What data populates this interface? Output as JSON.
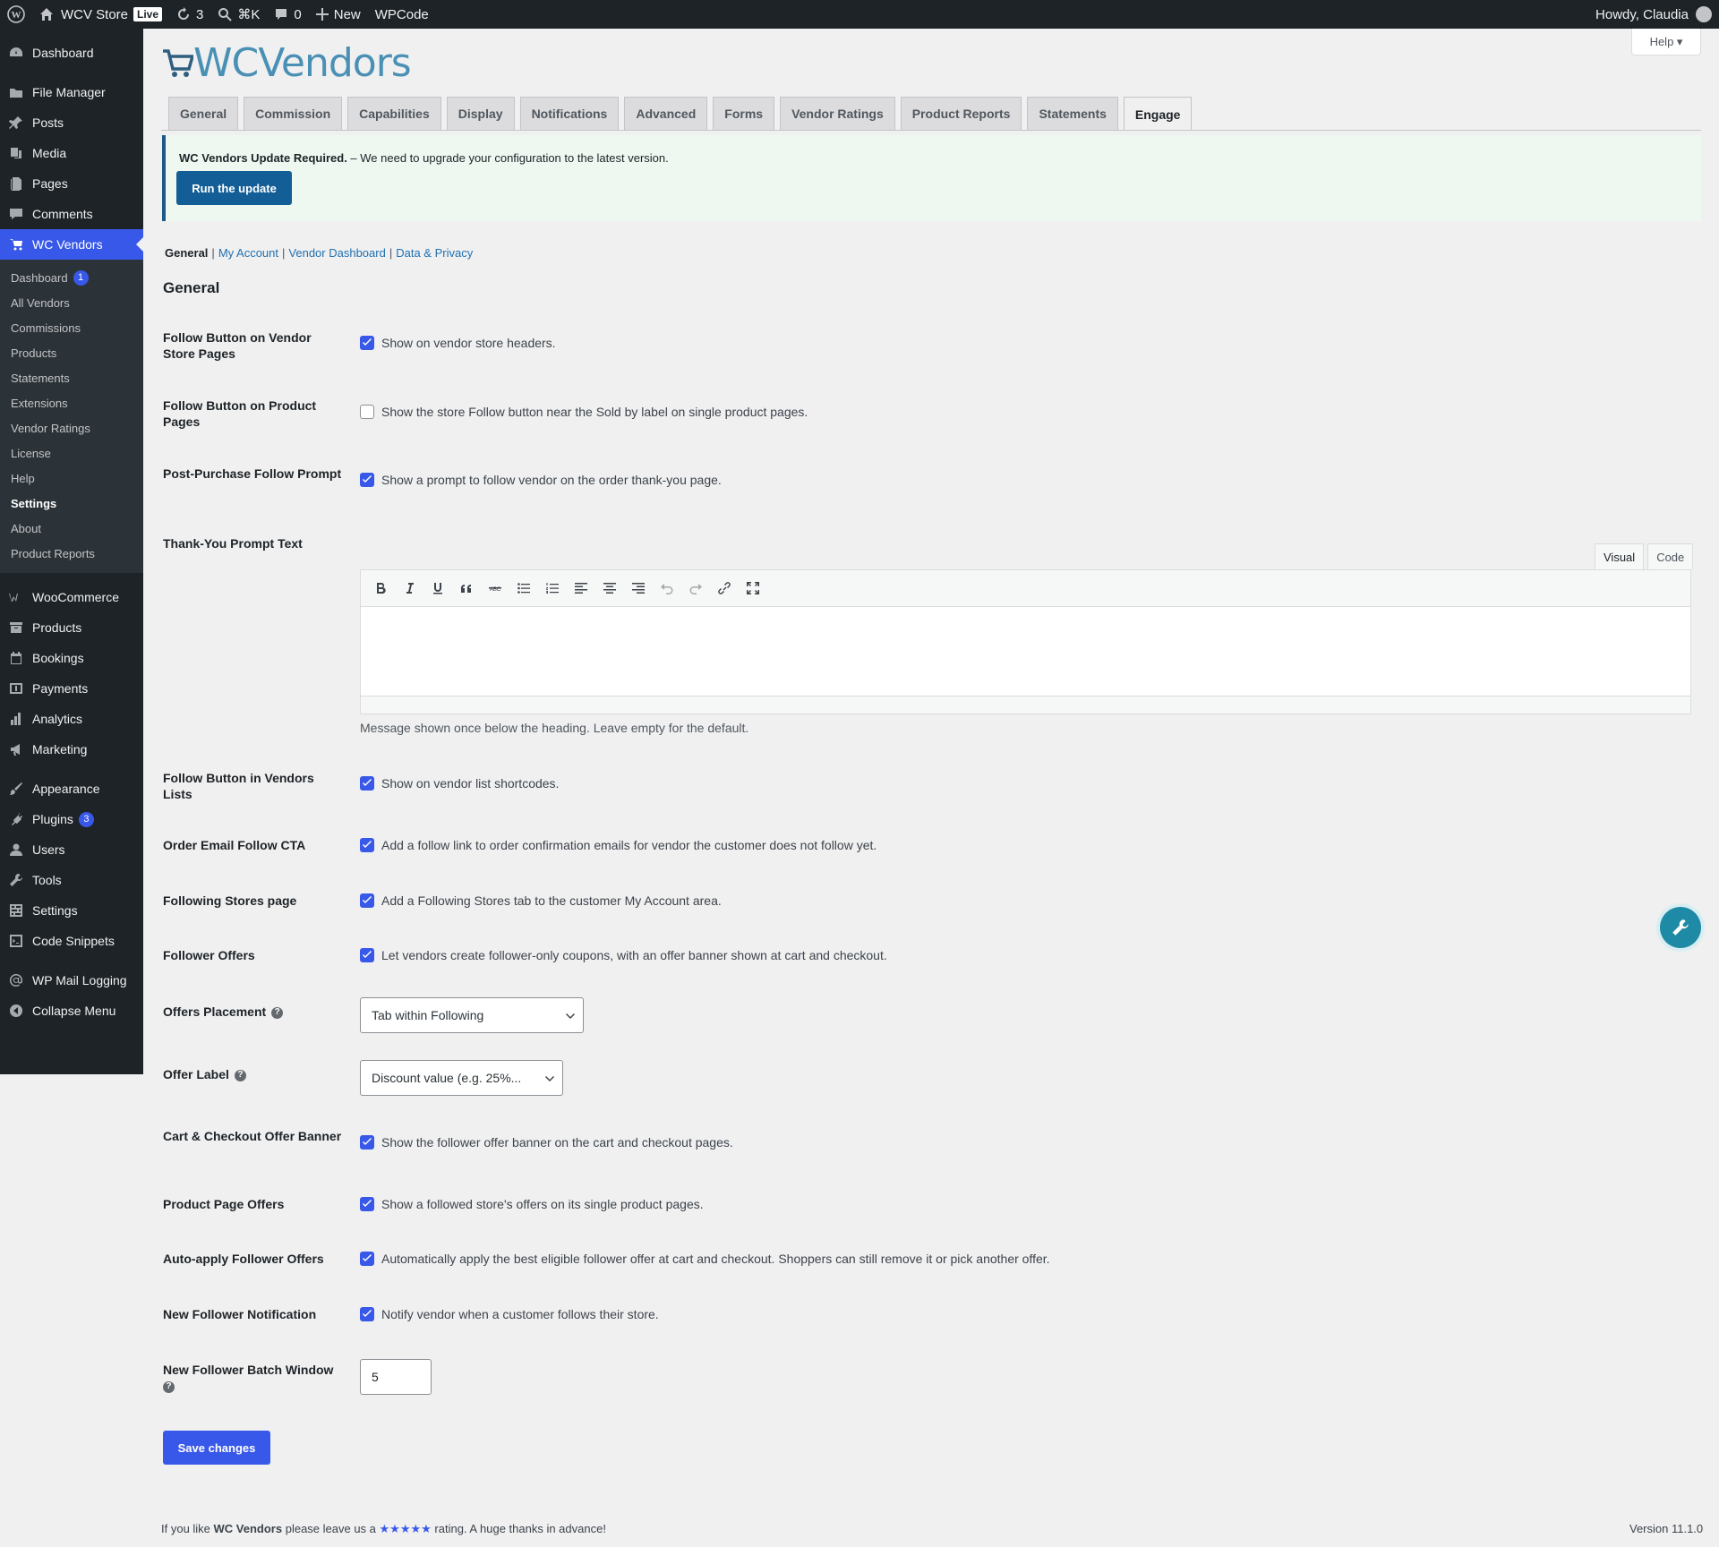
{
  "adminbar": {
    "site_name": "WCV Store",
    "live_badge": "Live",
    "updates_count": "3",
    "search_shortcut": "⌘K",
    "comments_count": "0",
    "new_label": "New",
    "wpcode_label": "WPCode",
    "howdy": "Howdy, Claudia"
  },
  "help_tab": "Help ▾",
  "sidebar": {
    "top_items": [
      {
        "label": "Dashboard"
      },
      {
        "label": "File Manager"
      },
      {
        "label": "Posts"
      },
      {
        "label": "Media"
      },
      {
        "label": "Pages"
      },
      {
        "label": "Comments"
      },
      {
        "label": "WC Vendors"
      }
    ],
    "submenu": [
      {
        "label": "Dashboard",
        "badge": "1"
      },
      {
        "label": "All Vendors"
      },
      {
        "label": "Commissions"
      },
      {
        "label": "Products"
      },
      {
        "label": "Statements"
      },
      {
        "label": "Extensions"
      },
      {
        "label": "Vendor Ratings"
      },
      {
        "label": "License"
      },
      {
        "label": "Help"
      },
      {
        "label": "Settings"
      },
      {
        "label": "About"
      },
      {
        "label": "Product Reports"
      }
    ],
    "bottom_items": [
      {
        "label": "WooCommerce"
      },
      {
        "label": "Products"
      },
      {
        "label": "Bookings"
      },
      {
        "label": "Payments"
      },
      {
        "label": "Analytics"
      },
      {
        "label": "Marketing"
      },
      {
        "label": "Appearance"
      },
      {
        "label": "Plugins",
        "badge": "3"
      },
      {
        "label": "Users"
      },
      {
        "label": "Tools"
      },
      {
        "label": "Settings"
      },
      {
        "label": "Code Snippets"
      },
      {
        "label": "WP Mail Logging"
      },
      {
        "label": "Collapse Menu"
      }
    ]
  },
  "logo_text": "WCVendors",
  "tabs": [
    "General",
    "Commission",
    "Capabilities",
    "Display",
    "Notifications",
    "Advanced",
    "Forms",
    "Vendor Ratings",
    "Product Reports",
    "Statements",
    "Engage"
  ],
  "notice": {
    "title": "WC Vendors Update Required.",
    "message": " – We need to upgrade your configuration to the latest version.",
    "button": "Run the update"
  },
  "subnav": {
    "current": "General",
    "links": [
      "My Account",
      "Vendor Dashboard",
      "Data & Privacy"
    ],
    "separator": "|"
  },
  "section_title": "General",
  "settings": {
    "follow_store": {
      "label": "Follow Button on Vendor Store Pages",
      "text": "Show on vendor store headers.",
      "checked": true
    },
    "follow_product": {
      "label": "Follow Button on Product Pages",
      "text": "Show the store Follow button near the Sold by label on single product pages.",
      "checked": false
    },
    "post_purchase": {
      "label": "Post-Purchase Follow Prompt",
      "text": "Show a prompt to follow vendor on the order thank-you page.",
      "checked": true
    },
    "thankyou_text": {
      "label": "Thank-You Prompt Text",
      "tab_visual": "Visual",
      "tab_code": "Code",
      "description": "Message shown once below the heading. Leave empty for the default."
    },
    "vendors_lists": {
      "label": "Follow Button in Vendors Lists",
      "text": "Show on vendor list shortcodes.",
      "checked": true
    },
    "order_email": {
      "label": "Order Email Follow CTA",
      "text": "Add a follow link to order confirmation emails for vendor the customer does not follow yet.",
      "checked": true
    },
    "following_stores": {
      "label": "Following Stores page",
      "text": "Add a Following Stores tab to the customer My Account area.",
      "checked": true
    },
    "follower_offers": {
      "label": "Follower Offers",
      "text": "Let vendors create follower-only coupons, with an offer banner shown at cart and checkout.",
      "checked": true
    },
    "offers_placement": {
      "label": "Offers Placement",
      "value": "Tab within Following"
    },
    "offer_label": {
      "label": "Offer Label",
      "value": "Discount value (e.g. 25%..."
    },
    "cart_banner": {
      "label": "Cart & Checkout Offer Banner",
      "text": "Show the follower offer banner on the cart and checkout pages.",
      "checked": true
    },
    "product_offers": {
      "label": "Product Page Offers",
      "text": "Show a followed store's offers on its single product pages.",
      "checked": true
    },
    "auto_apply": {
      "label": "Auto-apply Follower Offers",
      "text": "Automatically apply the best eligible follower offer at cart and checkout. Shoppers can still remove it or pick another offer.",
      "checked": true
    },
    "new_follower_notify": {
      "label": "New Follower Notification",
      "text": "Notify vendor when a customer follows their store.",
      "checked": true
    },
    "batch_window": {
      "label": "New Follower Batch Window",
      "value": "5"
    }
  },
  "save_button": "Save changes",
  "footer": {
    "prefix": "If you like ",
    "brand": "WC Vendors",
    "middle": " please leave us a ",
    "stars": "★★★★★",
    "suffix": " rating. A huge thanks in advance!",
    "version": "Version 11.1.0"
  }
}
